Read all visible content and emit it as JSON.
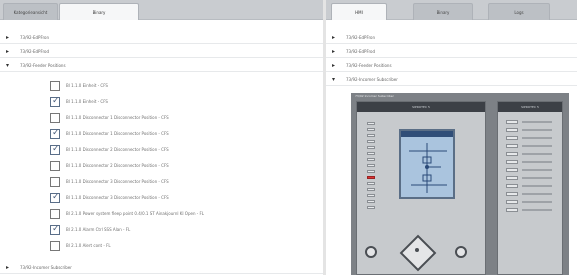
{
  "left_pane": {
    "tabs": [
      {
        "label": "Kategorieansicht",
        "active": false
      },
      {
        "label": "Binary",
        "active": true
      }
    ],
    "tree": [
      {
        "label": "73/92-EdPFron",
        "expanded": false
      },
      {
        "label": "73/92-EdPFrod",
        "expanded": false
      },
      {
        "label": "73/92-Feeder Positions",
        "expanded": true
      },
      {
        "label": "73/92-Incomer Subscriber",
        "expanded": false
      }
    ],
    "checkboxes": [
      {
        "label": "Bl 1.1.0 Einheit - CFS",
        "checked": false
      },
      {
        "label": "Bl 1.1.0 Einheit - CFS",
        "checked": true
      },
      {
        "label": "Bl 1.1.0 Disconnector 1 Disconnector Position - CFS",
        "checked": false
      },
      {
        "label": "Bl 1.1.0 Disconnector 1 Disconnector Position - CFS",
        "checked": true
      },
      {
        "label": "Bl 1.1.0 Disconnector 2 Disconnector Position - CFS",
        "checked": true
      },
      {
        "label": "Bl 1.1.0 Disconnector 2 Disconnector Position - CFS",
        "checked": false
      },
      {
        "label": "Bl 1.1.0 Disconnector 3 Disconnector Position - CFS",
        "checked": false
      },
      {
        "label": "Bl 1.1.0 Disconnector 3 Disconnector Position - CFS",
        "checked": true
      },
      {
        "label": "Bl 2.1.0 Power system fleep point 0.4/0.1 ST Ainakjournl KI Open - FL",
        "checked": false
      },
      {
        "label": "Bl 2.1.0 Alarm Ctrl SSS Alan - FL",
        "checked": true
      },
      {
        "label": "Bl 2.1.0 Alert cont - FL",
        "checked": false
      }
    ]
  },
  "right_pane": {
    "tabs": [
      {
        "label": "HMI",
        "active": true
      },
      {
        "label": "Binary",
        "active": false
      },
      {
        "label": "Logs",
        "active": false
      }
    ],
    "tree": [
      {
        "label": "73/92-EdPFron",
        "expanded": false
      },
      {
        "label": "73/92-EdPFrod",
        "expanded": false
      },
      {
        "label": "73/92-Feeder Positions",
        "expanded": false
      },
      {
        "label": "73/92-Incomer Subscriber",
        "expanded": true
      }
    ],
    "device": {
      "left_header": "SIPROTEC 5",
      "right_header": "SIPROTEC 5",
      "screen_caption": "73/92 Incomer Subscriber"
    }
  },
  "colors": {
    "tabbar": "#c9ccd0",
    "device_body": "#c7cacd",
    "screen": "#aac4de",
    "alarm_led": "#dd3333"
  }
}
